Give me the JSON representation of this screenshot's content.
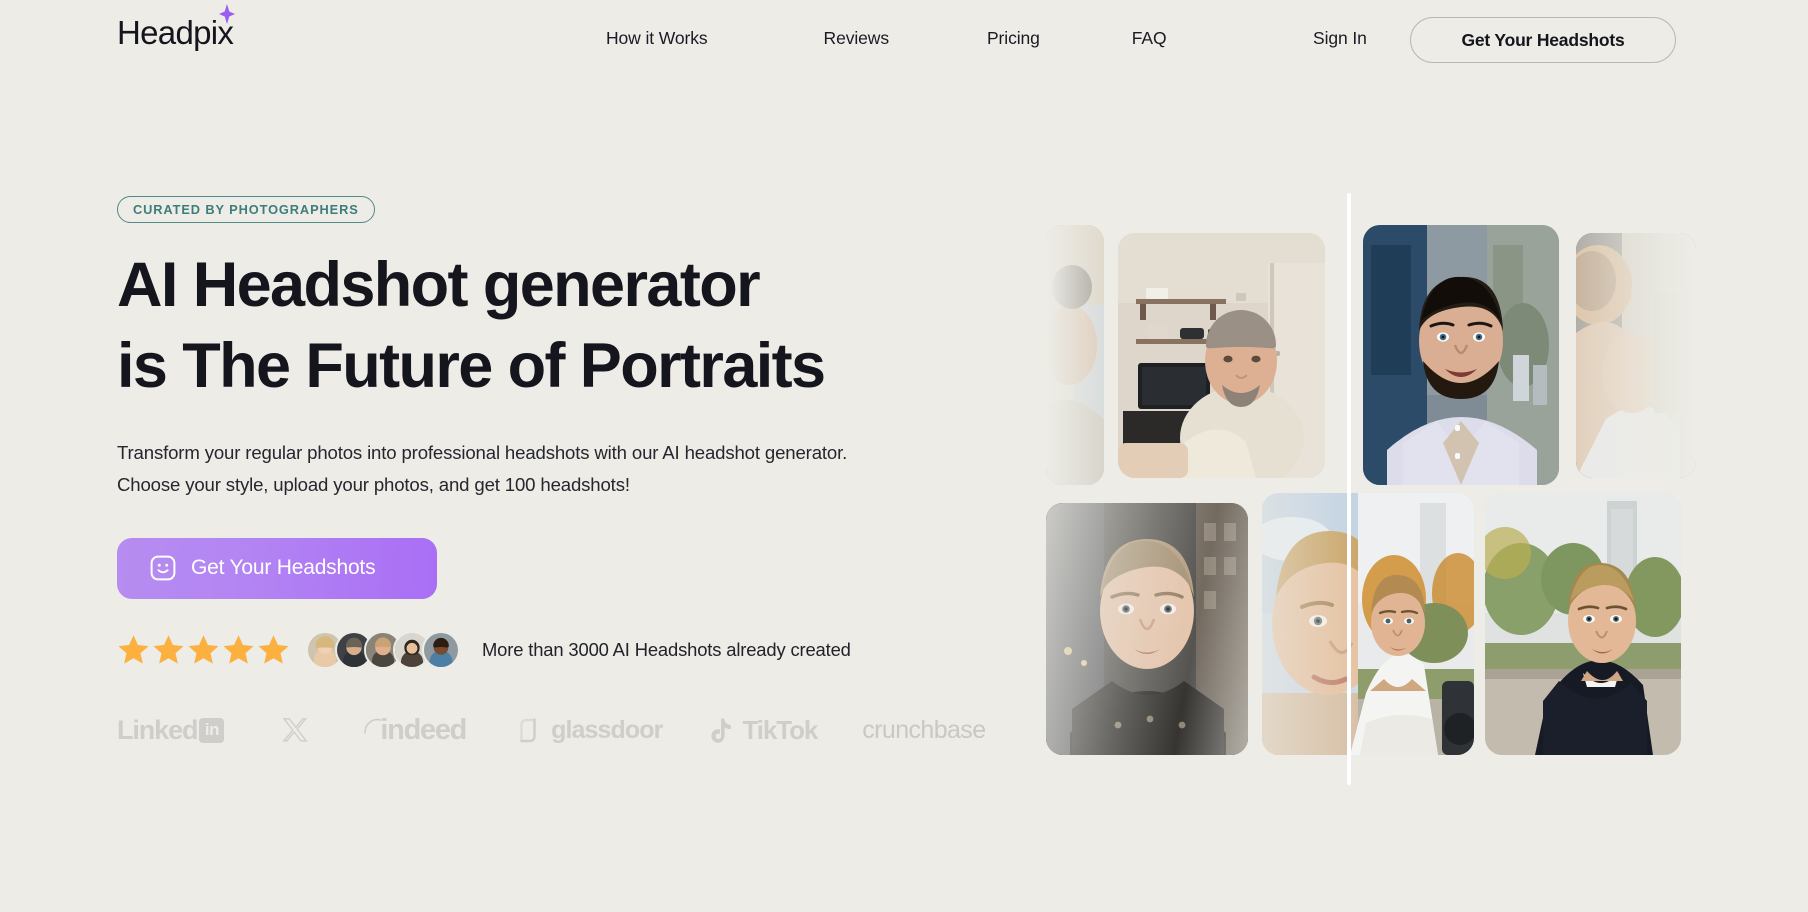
{
  "brand": {
    "name": "Headpix",
    "sparkle_icon": "sparkle-icon",
    "accent_purple": "#a96ef5"
  },
  "header": {
    "nav": [
      {
        "label": "How it Works",
        "name": "nav-how-it-works"
      },
      {
        "label": "Reviews",
        "name": "nav-reviews"
      },
      {
        "label": "Pricing",
        "name": "nav-pricing"
      },
      {
        "label": "FAQ",
        "name": "nav-faq"
      }
    ],
    "sign_in_label": "Sign In",
    "cta_label": "Get Your Headshots"
  },
  "hero": {
    "badge": "CURATED BY PHOTOGRAPHERS",
    "badge_color": "#3d7d7b",
    "headline_line1": "AI Headshot generator",
    "headline_line2": "is The Future of Portraits",
    "subcopy": "Transform your regular photos into professional headshots with our AI headshot generator. Choose your style, upload your photos, and get 100 headshots!",
    "cta_label": "Get Your Headshots",
    "cta_icon": "smiley-face-icon",
    "cta_gradient_from": "#b68cf0",
    "cta_gradient_to": "#a96ef5"
  },
  "social_proof": {
    "star_count": 5,
    "star_color": "#fbb040",
    "avatar_count": 5,
    "text": "More than 3000 AI Headshots already created"
  },
  "brand_logos": [
    {
      "label": "Linked",
      "badge": "in",
      "name": "logo-linkedin"
    },
    {
      "label": "X",
      "name": "logo-x"
    },
    {
      "label": "indeed",
      "name": "logo-indeed"
    },
    {
      "label": "glassdoor",
      "name": "logo-glassdoor"
    },
    {
      "label": "TikTok",
      "name": "logo-tiktok"
    },
    {
      "label": "crunchbase",
      "name": "logo-crunchbase"
    }
  ],
  "gallery": {
    "divider": "before-after-divider",
    "cards": [
      {
        "name": "gallery-card-partial-left",
        "kind": "before",
        "faded": true
      },
      {
        "name": "gallery-card-before-1",
        "kind": "before",
        "faded": false
      },
      {
        "name": "gallery-card-after-1",
        "kind": "after",
        "faded": false
      },
      {
        "name": "gallery-card-partial-right",
        "kind": "after",
        "faded": true
      },
      {
        "name": "gallery-card-before-2",
        "kind": "before",
        "faded": false
      },
      {
        "name": "gallery-card-split-2",
        "kind": "split",
        "faded": false
      },
      {
        "name": "gallery-card-after-2",
        "kind": "after",
        "faded": false
      }
    ]
  }
}
